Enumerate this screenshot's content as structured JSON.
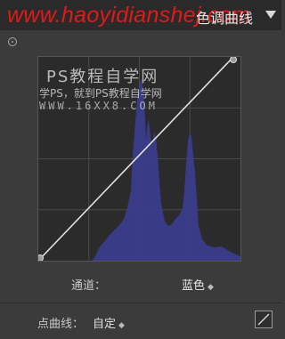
{
  "watermark": {
    "url": "www.haoyidianshej.com",
    "brand_title": "PS教程自学网",
    "tagline": "学PS，就到PS教程自学网",
    "site": "WWW.16XX8.COM"
  },
  "panel": {
    "title": "色调曲线",
    "channel_label": "通道：",
    "channel_value": "蓝色",
    "point_curve_label": "点曲线：",
    "point_curve_value": "自定"
  },
  "curve": {
    "start": [
      0,
      0
    ],
    "end": [
      255,
      255
    ],
    "line_color": "#e0e0e0",
    "histogram_color": "#3b3c8c"
  },
  "icons": {
    "collapse": "triangle-down-icon",
    "target_adjust": "target-icon",
    "updown": "updown-arrow-icon",
    "edit_curve": "diagonal-line-icon"
  }
}
